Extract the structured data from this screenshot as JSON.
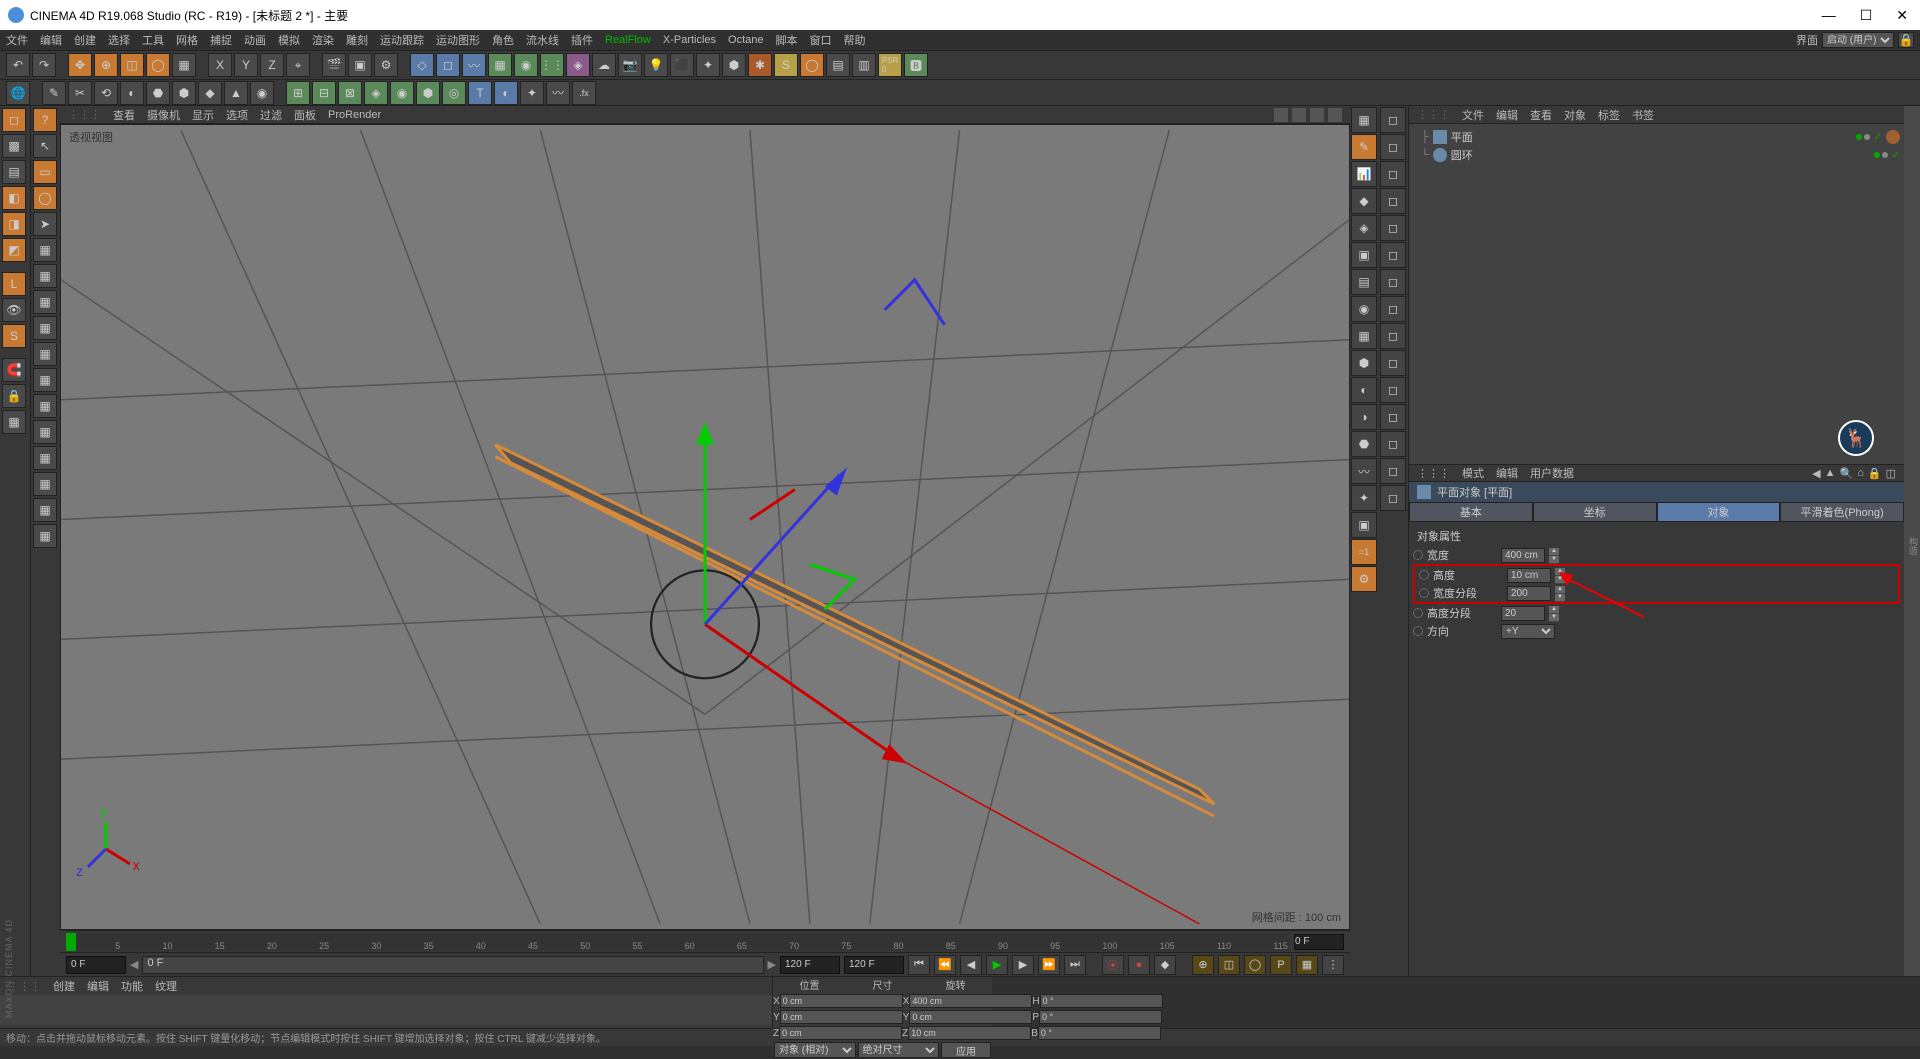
{
  "title": "CINEMA 4D R19.068 Studio (RC - R19) - [未标题 2 *] - 主要",
  "menu": [
    "文件",
    "编辑",
    "创建",
    "选择",
    "工具",
    "网格",
    "捕捉",
    "动画",
    "模拟",
    "渲染",
    "雕刻",
    "运动跟踪",
    "运动图形",
    "角色",
    "流水线",
    "插件"
  ],
  "menu_rf": "RealFlow",
  "menu2": [
    "X-Particles",
    "Octane",
    "脚本",
    "窗口",
    "帮助"
  ],
  "layout_lbl": "界面",
  "layout_val": "启动 (用户)",
  "vp_menu": [
    "查看",
    "摄像机",
    "显示",
    "选项",
    "过滤",
    "面板",
    "ProRender"
  ],
  "vp_label": "透视视图",
  "vp_status": "网格间距 : 100 cm",
  "om_menu": [
    "文件",
    "编辑",
    "查看",
    "对象",
    "标签",
    "书签"
  ],
  "tree": [
    {
      "name": "平面",
      "icon": "plane"
    },
    {
      "name": "圆环",
      "icon": "ring"
    }
  ],
  "attr_menu": [
    "模式",
    "编辑",
    "用户数据"
  ],
  "attr_title": "平面对象 [平面]",
  "tabs": [
    "基本",
    "坐标",
    "对象",
    "平滑着色(Phong)"
  ],
  "section": "对象属性",
  "attrs": {
    "width_lbl": "宽度",
    "width_val": "400 cm",
    "height_lbl": "高度",
    "height_val": "10 cm",
    "wseg_lbl": "宽度分段",
    "wseg_val": "200",
    "hseg_lbl": "高度分段",
    "hseg_val": "20",
    "dir_lbl": "方向",
    "dir_val": "+Y"
  },
  "timeline": {
    "ticks": [
      "0",
      "5",
      "10",
      "15",
      "20",
      "25",
      "30",
      "35",
      "40",
      "45",
      "50",
      "55",
      "60",
      "65",
      "70",
      "75",
      "80",
      "85",
      "90",
      "95",
      "100",
      "105",
      "110",
      "115"
    ]
  },
  "time": {
    "start": "0 F",
    "cur": "0 F",
    "end": "120 F",
    "end2": "120 F",
    "zero": "0 F"
  },
  "mat_menu": [
    "创建",
    "编辑",
    "功能",
    "纹理"
  ],
  "coord": {
    "headers": [
      "位置",
      "尺寸",
      "旋转"
    ],
    "rows": [
      {
        "l": "X",
        "p": "0 cm",
        "s": "X",
        "sv": "400 cm",
        "r": "H",
        "rv": "0 °"
      },
      {
        "l": "Y",
        "p": "0 cm",
        "s": "Y",
        "sv": "0 cm",
        "r": "P",
        "rv": "0 °"
      },
      {
        "l": "Z",
        "p": "0 cm",
        "s": "Z",
        "sv": "10 cm",
        "r": "B",
        "rv": "0 °"
      }
    ],
    "sel1": "对象 (相对)",
    "sel2": "绝对尺寸",
    "btn": "应用"
  },
  "status": "移动：点击并拖动鼠标移动元素。按住 SHIFT 键量化移动；节点编辑模式时按住 SHIFT 键增加选择对象；按住 CTRL 键减少选择对象。",
  "brand": "MAXON  CINEMA 4D"
}
